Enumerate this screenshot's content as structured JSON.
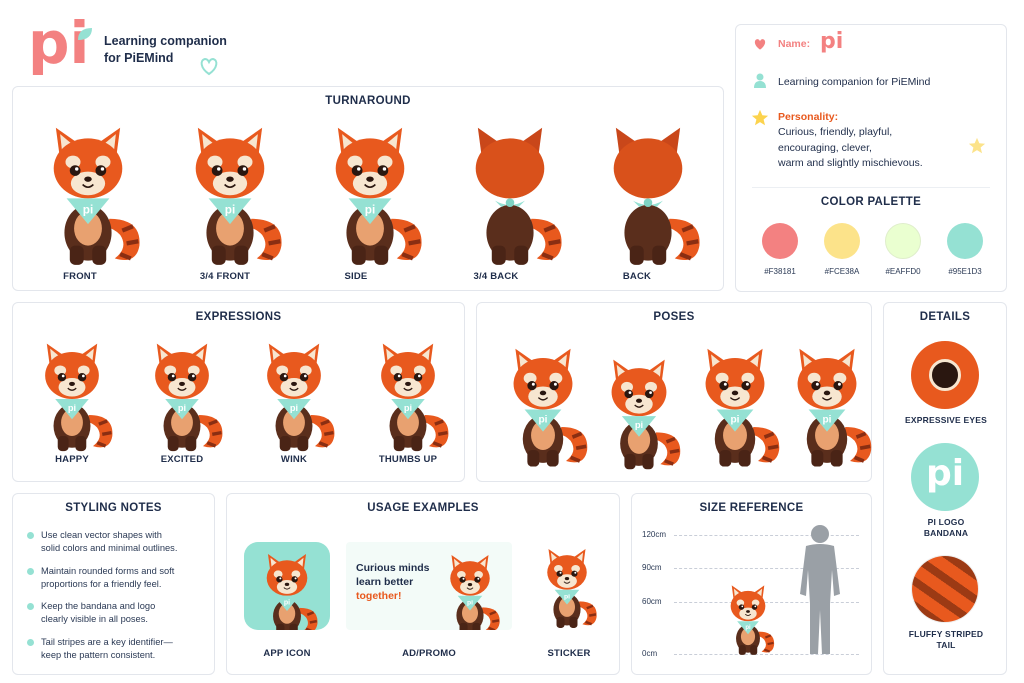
{
  "brand": {
    "logo": "pi",
    "tagline_1": "Learning companion",
    "tagline_2": "for PiEMind"
  },
  "info": {
    "name_label": "Name:",
    "name_value": "pi",
    "role": "Learning companion for PiEMind",
    "personality_label": "Personality:",
    "personality_lines": [
      "Curious, friendly, playful,",
      "encouraging, clever,",
      "warm and slightly mischievous."
    ]
  },
  "palette": {
    "title": "COLOR PALETTE",
    "colors": [
      {
        "hex": "#F38181",
        "label": "#F38181"
      },
      {
        "hex": "#FCE38A",
        "label": "#FCE38A"
      },
      {
        "hex": "#EAFFD0",
        "label": "#EAFFD0"
      },
      {
        "hex": "#95E1D3",
        "label": "#95E1D3"
      }
    ]
  },
  "turnaround": {
    "title": "TURNAROUND",
    "views": [
      "FRONT",
      "3/4 FRONT",
      "SIDE",
      "3/4 BACK",
      "BACK"
    ]
  },
  "expressions": {
    "title": "EXPRESSIONS",
    "items": [
      "HAPPY",
      "EXCITED",
      "WINK",
      "THUMBS UP"
    ]
  },
  "poses": {
    "title": "POSES"
  },
  "details": {
    "title": "DETAILS",
    "items": [
      "EXPRESSIVE EYES",
      "PI LOGO",
      "BANDANA",
      "FLUFFY STRIPED",
      "TAIL"
    ],
    "bandana_logo": "pi"
  },
  "styling": {
    "title": "STYLING NOTES",
    "notes": [
      [
        "Use clean vector shapes with",
        "solid colors and minimal outlines."
      ],
      [
        "Maintain rounded forms and soft",
        "proportions for a friendly feel."
      ],
      [
        "Keep the bandana and logo",
        "clearly visible in all poses."
      ],
      [
        "Tail stripes are a key identifier—",
        "keep the pattern consistent."
      ]
    ]
  },
  "usage": {
    "title": "USAGE EXAMPLES",
    "items": [
      "APP ICON",
      "AD/PROMO",
      "STICKER"
    ],
    "promo_line1": "Curious minds",
    "promo_line2": "learn better",
    "promo_line3": "together!"
  },
  "size": {
    "title": "SIZE REFERENCE",
    "ticks": [
      "120cm",
      "90cm",
      "60cm",
      "0cm"
    ]
  },
  "bandana_text": "pi",
  "colors": {
    "fur": "#E8591E",
    "fur_dark": "#C9471A",
    "cream": "#F7E6D0",
    "brown": "#5A2E1C",
    "mint": "#95E1D3",
    "text": "#1f2d4a"
  }
}
